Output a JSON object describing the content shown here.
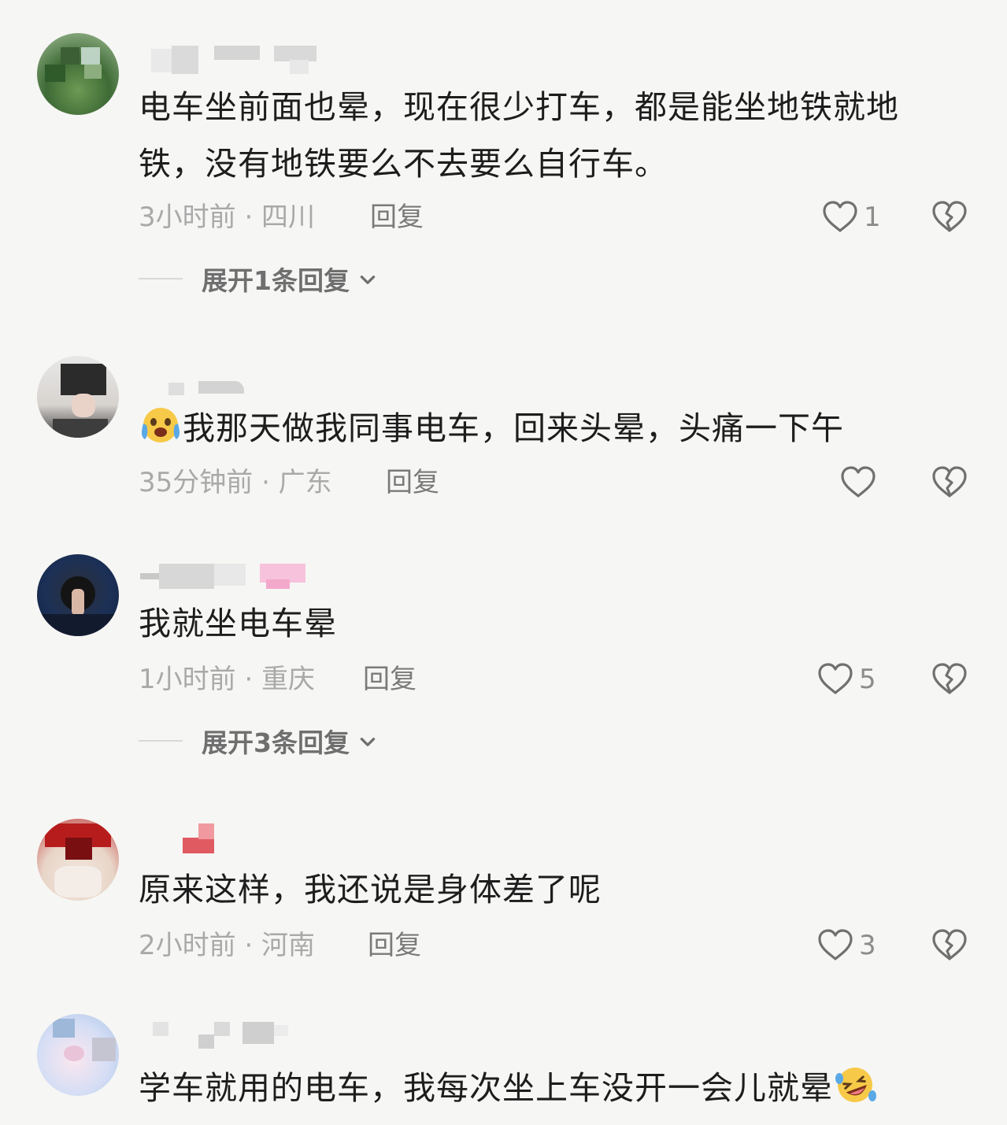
{
  "comments": [
    {
      "text": "电车坐前面也晕，现在很少打车，都是能坐地铁就地铁，没有地铁要么不去要么自行车。",
      "meta": "3小时前 · 四川",
      "reply_label": "回复",
      "likes": "1",
      "expand_label": "展开1条回复",
      "avatar_icon": "avatar-tree-photo"
    },
    {
      "emoji_icon": "crying-face-emoji",
      "text": "我那天做我同事电车，回来头晕，头痛一下午",
      "meta": "35分钟前 · 广东",
      "reply_label": "回复",
      "likes": "",
      "avatar_icon": "avatar-person-photo"
    },
    {
      "text": "我就坐电车晕",
      "meta": "1小时前 · 重庆",
      "reply_label": "回复",
      "likes": "5",
      "expand_label": "展开3条回复",
      "avatar_icon": "avatar-hooded-figure"
    },
    {
      "text": "原来这样，我还说是身体差了呢",
      "meta": "2小时前 · 河南",
      "reply_label": "回复",
      "likes": "3",
      "avatar_icon": "avatar-baby-photo"
    },
    {
      "text": "学车就用的电车，我每次坐上车没开一会儿就晕",
      "emoji_icon": "rolling-laughing-emoji",
      "avatar_icon": "avatar-pastel-photo"
    }
  ],
  "colors": {
    "background": "#f6f6f4",
    "body_text": "#1d1d1d",
    "meta_text": "#a9a9a9",
    "reply_text": "#7a7a7a",
    "icon_stroke": "#6e6e6e"
  }
}
